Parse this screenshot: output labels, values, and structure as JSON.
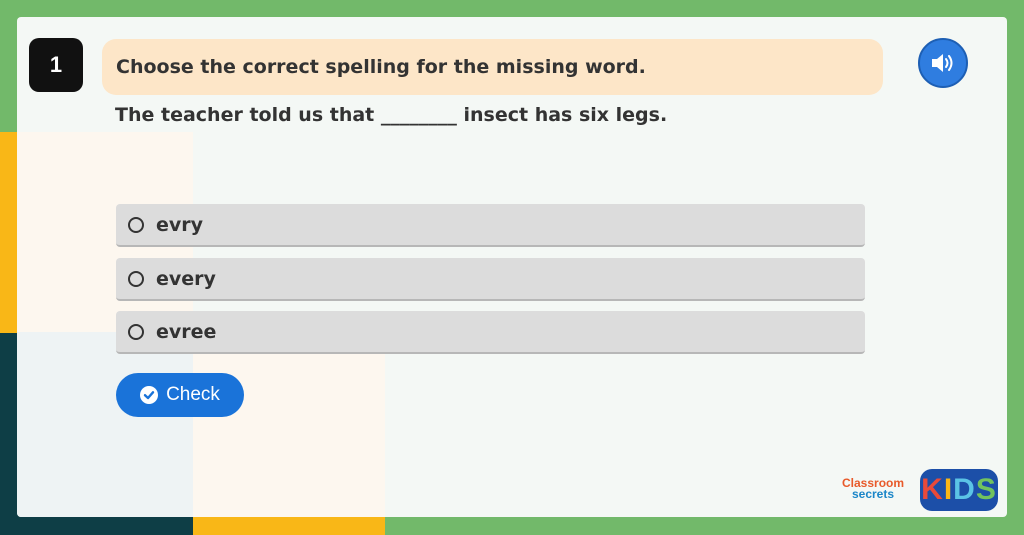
{
  "question": {
    "number": "1",
    "prompt": "Choose the correct spelling for the missing word.",
    "sentence": "The teacher told us that ________ insect has six legs."
  },
  "audio": {
    "icon": "speaker-icon"
  },
  "options": [
    {
      "label": "evry"
    },
    {
      "label": "every"
    },
    {
      "label": "evree"
    }
  ],
  "check": {
    "label": "Check",
    "icon": "check-circle-icon"
  },
  "brand": {
    "line1": "Classroom",
    "line2": "secrets",
    "kids": [
      "K",
      "I",
      "D",
      "S"
    ]
  },
  "colors": {
    "background_green": "#72b96a",
    "prompt_bg": "#fde6c8",
    "button_blue": "#1a73d9",
    "option_bg": "#dcdcdc"
  }
}
